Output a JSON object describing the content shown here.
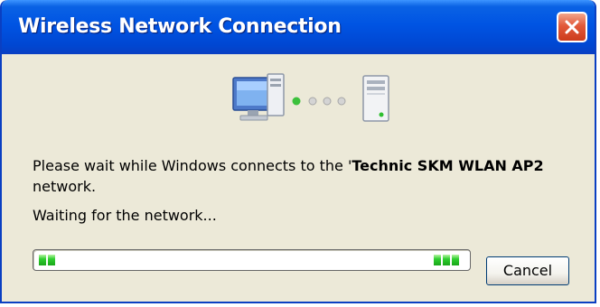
{
  "window": {
    "title": "Wireless Network Connection"
  },
  "message": {
    "prefix": "Please wait while Windows connects to the '",
    "network_name": "Technic SKM WLAN AP2",
    "suffix": "network."
  },
  "status_text": "Waiting for the network...",
  "buttons": {
    "cancel_label": "Cancel"
  },
  "icons": {
    "title_close": "close-icon",
    "connection": "network-connection-icon"
  },
  "colors": {
    "titlebar": "#0054e3",
    "close_button": "#e2593a",
    "dialog_bg": "#ece9d8",
    "progress_chunk": "#2fcf2f"
  }
}
